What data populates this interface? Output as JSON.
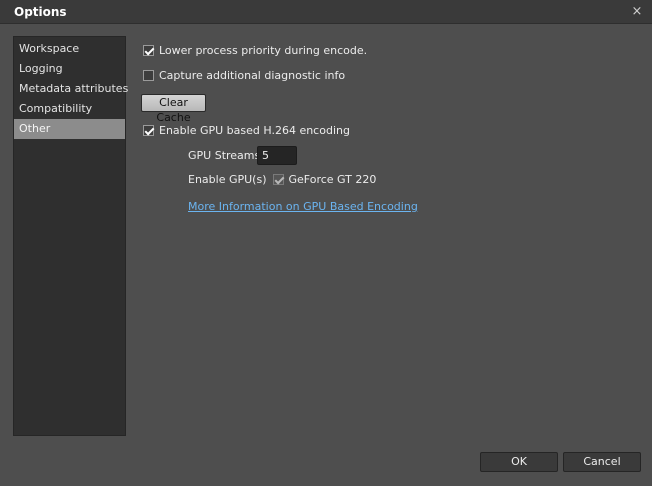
{
  "window": {
    "title": "Options",
    "close_glyph": "×"
  },
  "sidebar": {
    "items": [
      {
        "label": "Workspace",
        "selected": false
      },
      {
        "label": "Logging",
        "selected": false
      },
      {
        "label": "Metadata attributes",
        "selected": false
      },
      {
        "label": "Compatibility",
        "selected": false
      },
      {
        "label": "Other",
        "selected": true
      }
    ]
  },
  "options": {
    "lower_priority": {
      "label": "Lower process priority during encode.",
      "checked": true
    },
    "diagnostic": {
      "label": "Capture additional diagnostic info",
      "checked": false
    },
    "clear_cache_label": "Clear Cache",
    "gpu_encoding": {
      "label": "Enable GPU based H.264 encoding",
      "checked": true
    },
    "gpu_streams": {
      "label": "GPU Streams",
      "value": "5"
    },
    "enable_gpus": {
      "label": "Enable GPU(s)",
      "gpu_name": "GeForce GT 220",
      "checked": true
    },
    "more_info_link": "More Information on GPU Based Encoding"
  },
  "footer": {
    "ok_label": "OK",
    "cancel_label": "Cancel"
  },
  "colors": {
    "background": "#4e4e4e",
    "sidebar_bg": "#2f2f2f",
    "selected_item": "#8c8c8c",
    "link": "#6bb4f0"
  }
}
